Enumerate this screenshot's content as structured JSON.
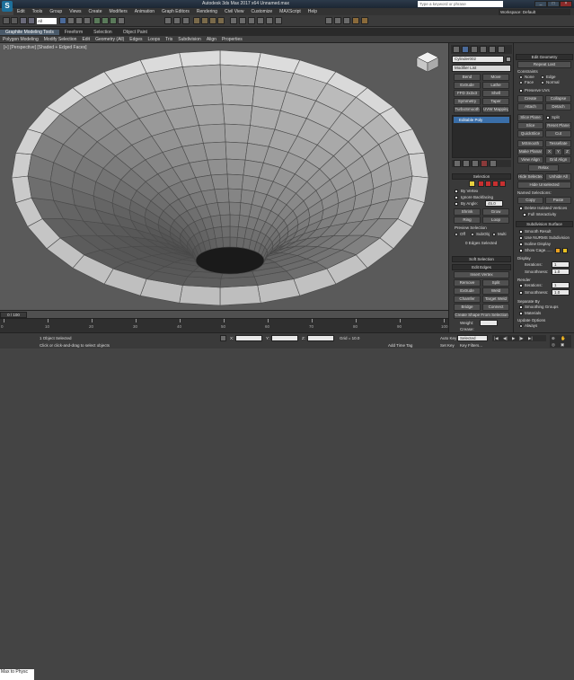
{
  "app": {
    "title": "Autodesk 3ds Max 2017 x64    Unnamed.max",
    "search_placeholder": "Type a keyword or phrase",
    "logo_letter": "S"
  },
  "menus": [
    "Edit",
    "Tools",
    "Group",
    "Views",
    "Create",
    "Modifiers",
    "Animation",
    "Graph Editors",
    "Rendering",
    "Civil View",
    "Customize",
    "MAXScript",
    "Help"
  ],
  "workspace": "Workspace: Default",
  "toolbar": {
    "filter": "All",
    "view": "View",
    "selset": "Create Selection Set"
  },
  "ribbon_tabs": [
    {
      "label": "Graphite Modeling Tools",
      "active": true
    },
    {
      "label": "Freeform",
      "active": false
    },
    {
      "label": "Selection",
      "active": false
    },
    {
      "label": "Object Paint",
      "active": false
    }
  ],
  "ribbon2": [
    "Polygon Modeling",
    "Modify Selection",
    "Edit",
    "Geometry (All)",
    "Edges",
    "Loops",
    "Tris",
    "Subdivision",
    "Align",
    "Properties"
  ],
  "viewport": {
    "label": "[+] [Perspective] [Shaded + Edged Faces]",
    "bg": "#5a5a5a",
    "mesh_fill": "#c8c8c8",
    "mesh_line": "#4a4a4a"
  },
  "cmd": {
    "object_name": "Cylinder002",
    "modifier_list": "Modifier List",
    "mods": [
      "Bend",
      "Move",
      "Extrude",
      "Lathe",
      "FFD 3x3x3",
      "Shell",
      "Symmetry",
      "Taper",
      "TurboSmooth",
      "UVW Mapping Cl"
    ],
    "stack_item": "Editable Poly",
    "selection": {
      "title": "Selection",
      "by_vertex": "By Vertex",
      "ignore_backfacing": "Ignore Backfacing",
      "by_angle": "By Angle:",
      "angle_value": "45.0",
      "shrink": "Shrink",
      "grow": "Grow",
      "ring": "Ring",
      "loop": "Loop",
      "preview_title": "Preview Selection",
      "off": "Off",
      "subobj": "SubObj",
      "multi": "Multi",
      "status": "0 Edges Selected"
    },
    "soft_selection": "Soft Selection",
    "edit_edges": {
      "title": "Edit Edges",
      "insert_vertex": "Insert Vertex",
      "remove": "Remove",
      "split": "Split",
      "extrude": "Extrude",
      "weld": "Weld",
      "chamfer": "Chamfer",
      "target_weld": "Target Weld",
      "bridge": "Bridge",
      "connect": "Connect",
      "create_shape": "Create Shape From Selection",
      "weight": "Weight:",
      "crease": "Crease:"
    }
  },
  "ep": {
    "edit_geometry": "Edit Geometry",
    "repeat_last": "Repeat Last",
    "constraints": "Constraints",
    "none": "None",
    "edge": "Edge",
    "face": "Face",
    "normal": "Normal",
    "preserve_uvs": "Preserve UVs",
    "create": "Create",
    "collapse": "Collapse",
    "attach": "Attach",
    "detach": "Detach",
    "slice_plane": "Slice Plane",
    "split": "Split",
    "slice": "Slice",
    "reset_plane": "Reset Plane",
    "quickslice": "QuickSlice",
    "cut": "Cut",
    "msmooth": "MSmooth",
    "tessellate": "Tessellate",
    "make_planar": "Make Planar",
    "x": "X",
    "y": "Y",
    "z": "Z",
    "view_align": "View Align",
    "grid_align": "Grid Align",
    "relax": "Relax",
    "hide_selected": "Hide Selected",
    "unhide_all": "Unhide All",
    "hide_unselected": "Hide Unselected",
    "named_selections": "Named Selections:",
    "copy": "Copy",
    "paste": "Paste",
    "delete_isolated": "Delete Isolated Vertices",
    "full_interactivity": "Full Interactivity",
    "subdiv_surface": "Subdivision Surface",
    "smooth_result": "Smooth Result",
    "use_nurms": "Use NURMS Subdivision",
    "isoline": "Isoline Display",
    "show_cage": "Show Cage......",
    "display": "Display",
    "iterations_label": "Iterations:",
    "iterations": "1",
    "smoothness_label": "Smoothness:",
    "smoothness": "1.0",
    "render": "Render",
    "separate_by": "Separate By",
    "smoothing_groups": "Smoothing Groups",
    "materials": "Materials",
    "update_options": "Update Options",
    "always": "Always",
    "when_rendering": "When Rendering",
    "manually": "Manually"
  },
  "timeline": {
    "frame": "0 / 100",
    "ticks": [
      "0",
      "10",
      "20",
      "30",
      "40",
      "50",
      "60",
      "70",
      "80",
      "90",
      "100"
    ]
  },
  "status": {
    "maxscript": "Max to Physc",
    "selected": "1 Object Selected",
    "prompt": "Click or click-and-drag to select objects",
    "x": "X:",
    "y": "Y:",
    "z": "Z:",
    "grid": "Grid = 10.0",
    "add_time_tag": "Add Time Tag",
    "auto_key": "Auto Key",
    "set_key": "Set Key",
    "key_filter": "Key Filters...",
    "sel_mode": "Selected"
  }
}
